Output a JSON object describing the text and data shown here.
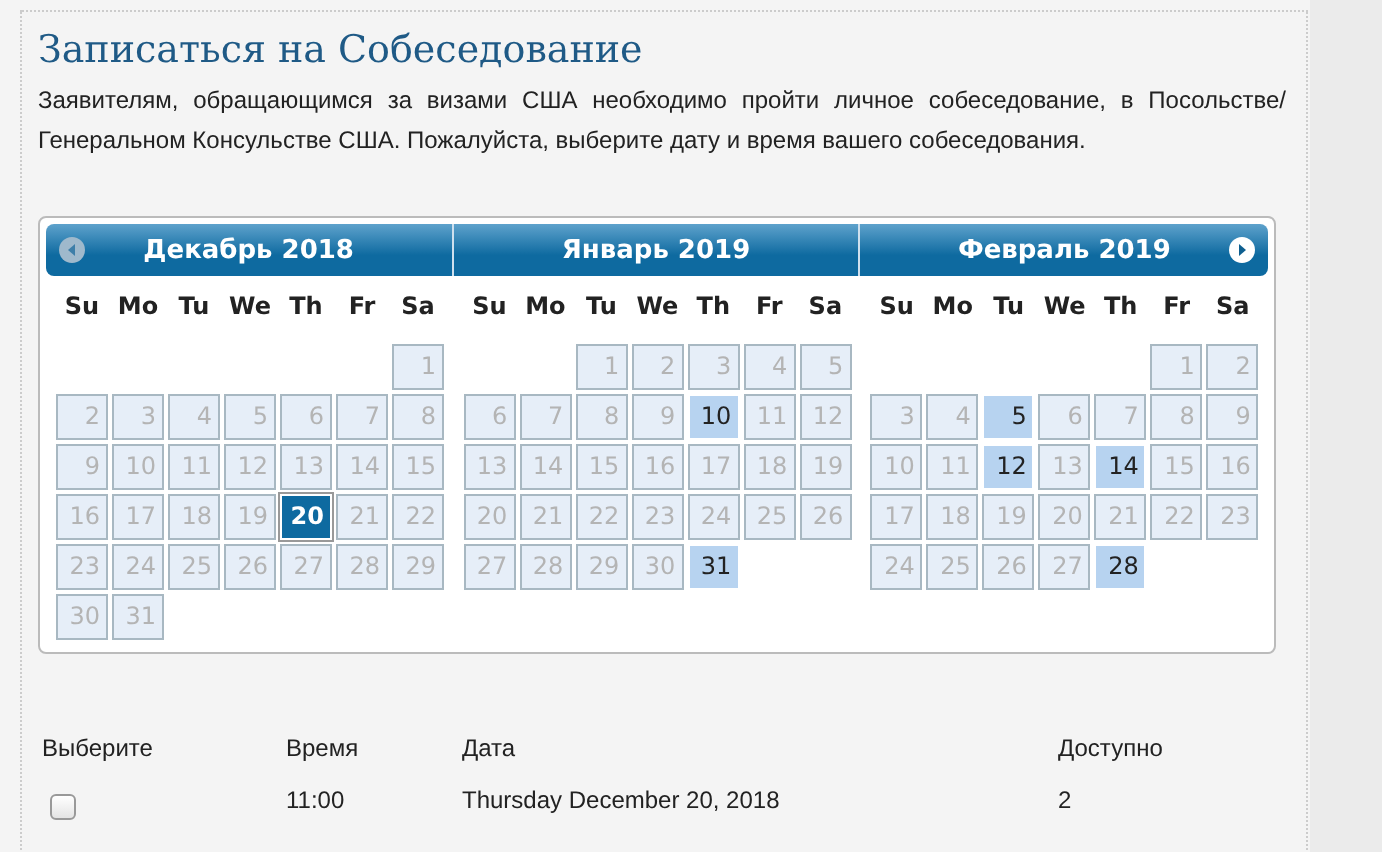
{
  "title": "Записаться на Собеседование",
  "intro": "Заявителям, обращающимся за визами США необходимо пройти личное собеседование, в Посольстве/ Генеральном Консульстве США. Пожалуйста, выберите дату и время вашего собеседования.",
  "months": [
    {
      "title": "Декабрь 2018",
      "weekdays": [
        "Su",
        "Mo",
        "Tu",
        "We",
        "Th",
        "Fr",
        "Sa"
      ],
      "weeks": [
        [
          {
            "day": "1",
            "available": false,
            "selected": false
          }
        ],
        [
          {
            "day": "2",
            "available": false,
            "selected": false
          },
          {
            "day": "3",
            "available": false,
            "selected": false
          },
          {
            "day": "4",
            "available": false,
            "selected": false
          },
          {
            "day": "5",
            "available": false,
            "selected": false
          },
          {
            "day": "6",
            "available": false,
            "selected": false
          },
          {
            "day": "7",
            "available": false,
            "selected": false
          },
          {
            "day": "8",
            "available": false,
            "selected": false
          }
        ],
        [
          {
            "day": "9",
            "available": false,
            "selected": false
          },
          {
            "day": "10",
            "available": false,
            "selected": false
          },
          {
            "day": "11",
            "available": false,
            "selected": false
          },
          {
            "day": "12",
            "available": false,
            "selected": false
          },
          {
            "day": "13",
            "available": false,
            "selected": false
          },
          {
            "day": "14",
            "available": false,
            "selected": false
          },
          {
            "day": "15",
            "available": false,
            "selected": false
          }
        ],
        [
          {
            "day": "16",
            "available": false,
            "selected": false
          },
          {
            "day": "17",
            "available": false,
            "selected": false
          },
          {
            "day": "18",
            "available": false,
            "selected": false
          },
          {
            "day": "19",
            "available": false,
            "selected": false
          },
          {
            "day": "20",
            "available": true,
            "selected": true
          },
          {
            "day": "21",
            "available": false,
            "selected": false
          },
          {
            "day": "22",
            "available": false,
            "selected": false
          }
        ],
        [
          {
            "day": "23",
            "available": false,
            "selected": false
          },
          {
            "day": "24",
            "available": false,
            "selected": false
          },
          {
            "day": "25",
            "available": false,
            "selected": false
          },
          {
            "day": "26",
            "available": false,
            "selected": false
          },
          {
            "day": "27",
            "available": false,
            "selected": false
          },
          {
            "day": "28",
            "available": false,
            "selected": false
          },
          {
            "day": "29",
            "available": false,
            "selected": false
          }
        ],
        [
          {
            "day": "30",
            "available": false,
            "selected": false
          },
          {
            "day": "31",
            "available": false,
            "selected": false
          }
        ]
      ]
    },
    {
      "title": "Январь 2019",
      "weekdays": [
        "Su",
        "Mo",
        "Tu",
        "We",
        "Th",
        "Fr",
        "Sa"
      ],
      "weeks": [
        [
          {
            "day": "1",
            "available": false,
            "selected": false
          },
          {
            "day": "2",
            "available": false,
            "selected": false
          },
          {
            "day": "3",
            "available": false,
            "selected": false
          },
          {
            "day": "4",
            "available": false,
            "selected": false
          },
          {
            "day": "5",
            "available": false,
            "selected": false
          }
        ],
        [
          {
            "day": "6",
            "available": false,
            "selected": false
          },
          {
            "day": "7",
            "available": false,
            "selected": false
          },
          {
            "day": "8",
            "available": false,
            "selected": false
          },
          {
            "day": "9",
            "available": false,
            "selected": false
          },
          {
            "day": "10",
            "available": true,
            "selected": false
          },
          {
            "day": "11",
            "available": false,
            "selected": false
          },
          {
            "day": "12",
            "available": false,
            "selected": false
          }
        ],
        [
          {
            "day": "13",
            "available": false,
            "selected": false
          },
          {
            "day": "14",
            "available": false,
            "selected": false
          },
          {
            "day": "15",
            "available": false,
            "selected": false
          },
          {
            "day": "16",
            "available": false,
            "selected": false
          },
          {
            "day": "17",
            "available": false,
            "selected": false
          },
          {
            "day": "18",
            "available": false,
            "selected": false
          },
          {
            "day": "19",
            "available": false,
            "selected": false
          }
        ],
        [
          {
            "day": "20",
            "available": false,
            "selected": false
          },
          {
            "day": "21",
            "available": false,
            "selected": false
          },
          {
            "day": "22",
            "available": false,
            "selected": false
          },
          {
            "day": "23",
            "available": false,
            "selected": false
          },
          {
            "day": "24",
            "available": false,
            "selected": false
          },
          {
            "day": "25",
            "available": false,
            "selected": false
          },
          {
            "day": "26",
            "available": false,
            "selected": false
          }
        ],
        [
          {
            "day": "27",
            "available": false,
            "selected": false
          },
          {
            "day": "28",
            "available": false,
            "selected": false
          },
          {
            "day": "29",
            "available": false,
            "selected": false
          },
          {
            "day": "30",
            "available": false,
            "selected": false
          },
          {
            "day": "31",
            "available": true,
            "selected": false
          }
        ]
      ]
    },
    {
      "title": "Февраль 2019",
      "weekdays": [
        "Su",
        "Mo",
        "Tu",
        "We",
        "Th",
        "Fr",
        "Sa"
      ],
      "weeks": [
        [
          {
            "day": "1",
            "available": false,
            "selected": false
          },
          {
            "day": "2",
            "available": false,
            "selected": false
          }
        ],
        [
          {
            "day": "3",
            "available": false,
            "selected": false
          },
          {
            "day": "4",
            "available": false,
            "selected": false
          },
          {
            "day": "5",
            "available": true,
            "selected": false
          },
          {
            "day": "6",
            "available": false,
            "selected": false
          },
          {
            "day": "7",
            "available": false,
            "selected": false
          },
          {
            "day": "8",
            "available": false,
            "selected": false
          },
          {
            "day": "9",
            "available": false,
            "selected": false
          }
        ],
        [
          {
            "day": "10",
            "available": false,
            "selected": false
          },
          {
            "day": "11",
            "available": false,
            "selected": false
          },
          {
            "day": "12",
            "available": true,
            "selected": false
          },
          {
            "day": "13",
            "available": false,
            "selected": false
          },
          {
            "day": "14",
            "available": true,
            "selected": false
          },
          {
            "day": "15",
            "available": false,
            "selected": false
          },
          {
            "day": "16",
            "available": false,
            "selected": false
          }
        ],
        [
          {
            "day": "17",
            "available": false,
            "selected": false
          },
          {
            "day": "18",
            "available": false,
            "selected": false
          },
          {
            "day": "19",
            "available": false,
            "selected": false
          },
          {
            "day": "20",
            "available": false,
            "selected": false
          },
          {
            "day": "21",
            "available": false,
            "selected": false
          },
          {
            "day": "22",
            "available": false,
            "selected": false
          },
          {
            "day": "23",
            "available": false,
            "selected": false
          }
        ],
        [
          {
            "day": "24",
            "available": false,
            "selected": false
          },
          {
            "day": "25",
            "available": false,
            "selected": false
          },
          {
            "day": "26",
            "available": false,
            "selected": false
          },
          {
            "day": "27",
            "available": false,
            "selected": false
          },
          {
            "day": "28",
            "available": true,
            "selected": false
          }
        ]
      ]
    }
  ],
  "table": {
    "columns": [
      "Выберите",
      "Время",
      "Дата",
      "Доступно"
    ],
    "rows": [
      {
        "checked": false,
        "time": "11:00",
        "date": "Thursday December 20, 2018",
        "count": "2"
      }
    ]
  }
}
